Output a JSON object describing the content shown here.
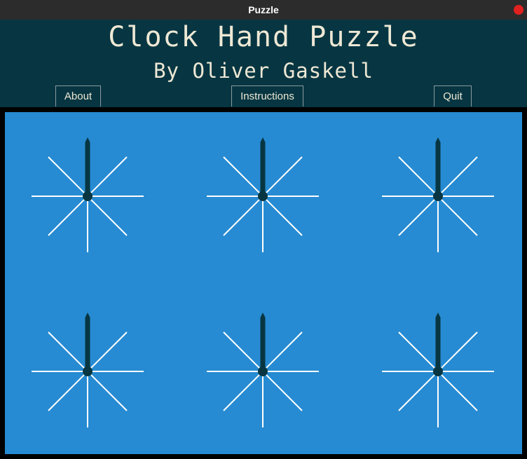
{
  "window": {
    "title": "Puzzle"
  },
  "header": {
    "title": "Clock Hand Puzzle",
    "subtitle": "By Oliver Gaskell",
    "buttons": {
      "about": "About",
      "instructions": "Instructions",
      "quit": "Quit"
    }
  },
  "colors": {
    "header_bg": "#073642",
    "board_bg": "#268bd2",
    "spoke": "#ffffff",
    "hand": "#073642",
    "close_button": "#e0211f"
  },
  "clocks": [
    {
      "hand_angle_deg": 0
    },
    {
      "hand_angle_deg": 0
    },
    {
      "hand_angle_deg": 0
    },
    {
      "hand_angle_deg": 0
    },
    {
      "hand_angle_deg": 0
    },
    {
      "hand_angle_deg": 0
    }
  ]
}
